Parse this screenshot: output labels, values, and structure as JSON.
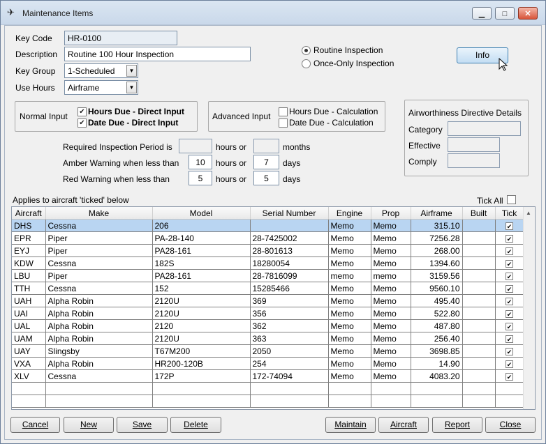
{
  "window": {
    "title": "Maintenance Items",
    "minimize": "▭",
    "maximize": "□",
    "close": "✕"
  },
  "form": {
    "key_code_label": "Key Code",
    "key_code": "HR-0100",
    "description_label": "Description",
    "description": "Routine 100 Hour Inspection",
    "key_group_label": "Key Group",
    "key_group": "1-Scheduled",
    "use_hours_label": "Use Hours",
    "use_hours": "Airframe"
  },
  "inspection_type": {
    "routine_label": "Routine Inspection",
    "routine_selected": true,
    "once_only_label": "Once-Only Inspection",
    "once_only_selected": false
  },
  "info_button": "Info",
  "normal_input": {
    "label": "Normal Input",
    "hours_due_label": "Hours Due - Direct Input",
    "hours_due_checked": true,
    "date_due_label": "Date Due - Direct Input",
    "date_due_checked": true
  },
  "advanced_input": {
    "label": "Advanced Input",
    "hours_due_label": "Hours Due - Calculation",
    "hours_due_checked": false,
    "date_due_label": "Date Due - Calculation",
    "date_due_checked": false
  },
  "airworthiness": {
    "title": "Airworthiness Directive Details",
    "category_label": "Category",
    "effective_label": "Effective",
    "comply_label": "Comply"
  },
  "period": {
    "required_label": "Required Inspection Period is",
    "required_hours": "",
    "hours_or": "hours or",
    "required_months": "",
    "months": "months",
    "amber_label": "Amber Warning when less than",
    "amber_hours": "10",
    "amber_days": "7",
    "red_label": "Red Warning when less than",
    "red_hours": "5",
    "red_days": "5",
    "days": "days"
  },
  "applies_label": "Applies to aircraft 'ticked' below",
  "tick_all_label": "Tick All",
  "table": {
    "columns": [
      "Aircraft",
      "Make",
      "Model",
      "Serial Number",
      "Engine",
      "Prop",
      "Airframe",
      "Built",
      "Tick"
    ],
    "rows": [
      {
        "aircraft": "DHS",
        "make": "Cessna",
        "model": "206",
        "serial": "",
        "engine": "Memo",
        "prop": "Memo",
        "airframe": "315.10",
        "built": "",
        "tick": true
      },
      {
        "aircraft": "EPR",
        "make": "Piper",
        "model": "PA-28-140",
        "serial": "28-7425002",
        "engine": "Memo",
        "prop": "Memo",
        "airframe": "7256.28",
        "built": "",
        "tick": true
      },
      {
        "aircraft": "EYJ",
        "make": "Piper",
        "model": "PA28-161",
        "serial": "28-801613",
        "engine": "Memo",
        "prop": "Memo",
        "airframe": "268.00",
        "built": "",
        "tick": true
      },
      {
        "aircraft": "KDW",
        "make": "Cessna",
        "model": "182S",
        "serial": "18280054",
        "engine": "Memo",
        "prop": "Memo",
        "airframe": "1394.60",
        "built": "",
        "tick": true
      },
      {
        "aircraft": "LBU",
        "make": "Piper",
        "model": "PA28-161",
        "serial": "28-7816099",
        "engine": "memo",
        "prop": "memo",
        "airframe": "3159.56",
        "built": "",
        "tick": true
      },
      {
        "aircraft": "TTH",
        "make": "Cessna",
        "model": "152",
        "serial": "15285466",
        "engine": "Memo",
        "prop": "Memo",
        "airframe": "9560.10",
        "built": "",
        "tick": true
      },
      {
        "aircraft": "UAH",
        "make": "Alpha Robin",
        "model": "2120U",
        "serial": "369",
        "engine": "Memo",
        "prop": "Memo",
        "airframe": "495.40",
        "built": "",
        "tick": true
      },
      {
        "aircraft": "UAI",
        "make": "Alpha Robin",
        "model": "2120U",
        "serial": "356",
        "engine": "Memo",
        "prop": "Memo",
        "airframe": "522.80",
        "built": "",
        "tick": true
      },
      {
        "aircraft": "UAL",
        "make": "Alpha Robin",
        "model": "2120",
        "serial": "362",
        "engine": "Memo",
        "prop": "Memo",
        "airframe": "487.80",
        "built": "",
        "tick": true
      },
      {
        "aircraft": "UAM",
        "make": "Alpha Robin",
        "model": "2120U",
        "serial": "363",
        "engine": "Memo",
        "prop": "Memo",
        "airframe": "256.40",
        "built": "",
        "tick": true
      },
      {
        "aircraft": "UAY",
        "make": "Slingsby",
        "model": "T67M200",
        "serial": "2050",
        "engine": "Memo",
        "prop": "Memo",
        "airframe": "3698.85",
        "built": "",
        "tick": true
      },
      {
        "aircraft": "VXA",
        "make": "Alpha Robin",
        "model": "HR200-120B",
        "serial": "254",
        "engine": "Memo",
        "prop": "Memo",
        "airframe": "14.90",
        "built": "",
        "tick": true
      },
      {
        "aircraft": "XLV",
        "make": "Cessna",
        "model": "172P",
        "serial": "172-74094",
        "engine": "Memo",
        "prop": "Memo",
        "airframe": "4083.20",
        "built": "",
        "tick": true
      }
    ]
  },
  "buttons": {
    "cancel": "Cancel",
    "new": "New",
    "save": "Save",
    "delete": "Delete",
    "maintain": "Maintain",
    "aircraft": "Aircraft",
    "report": "Report",
    "close": "Close"
  },
  "colors": {
    "selected_row": "#b9d5f2",
    "info_button": "#c3ddf3"
  }
}
